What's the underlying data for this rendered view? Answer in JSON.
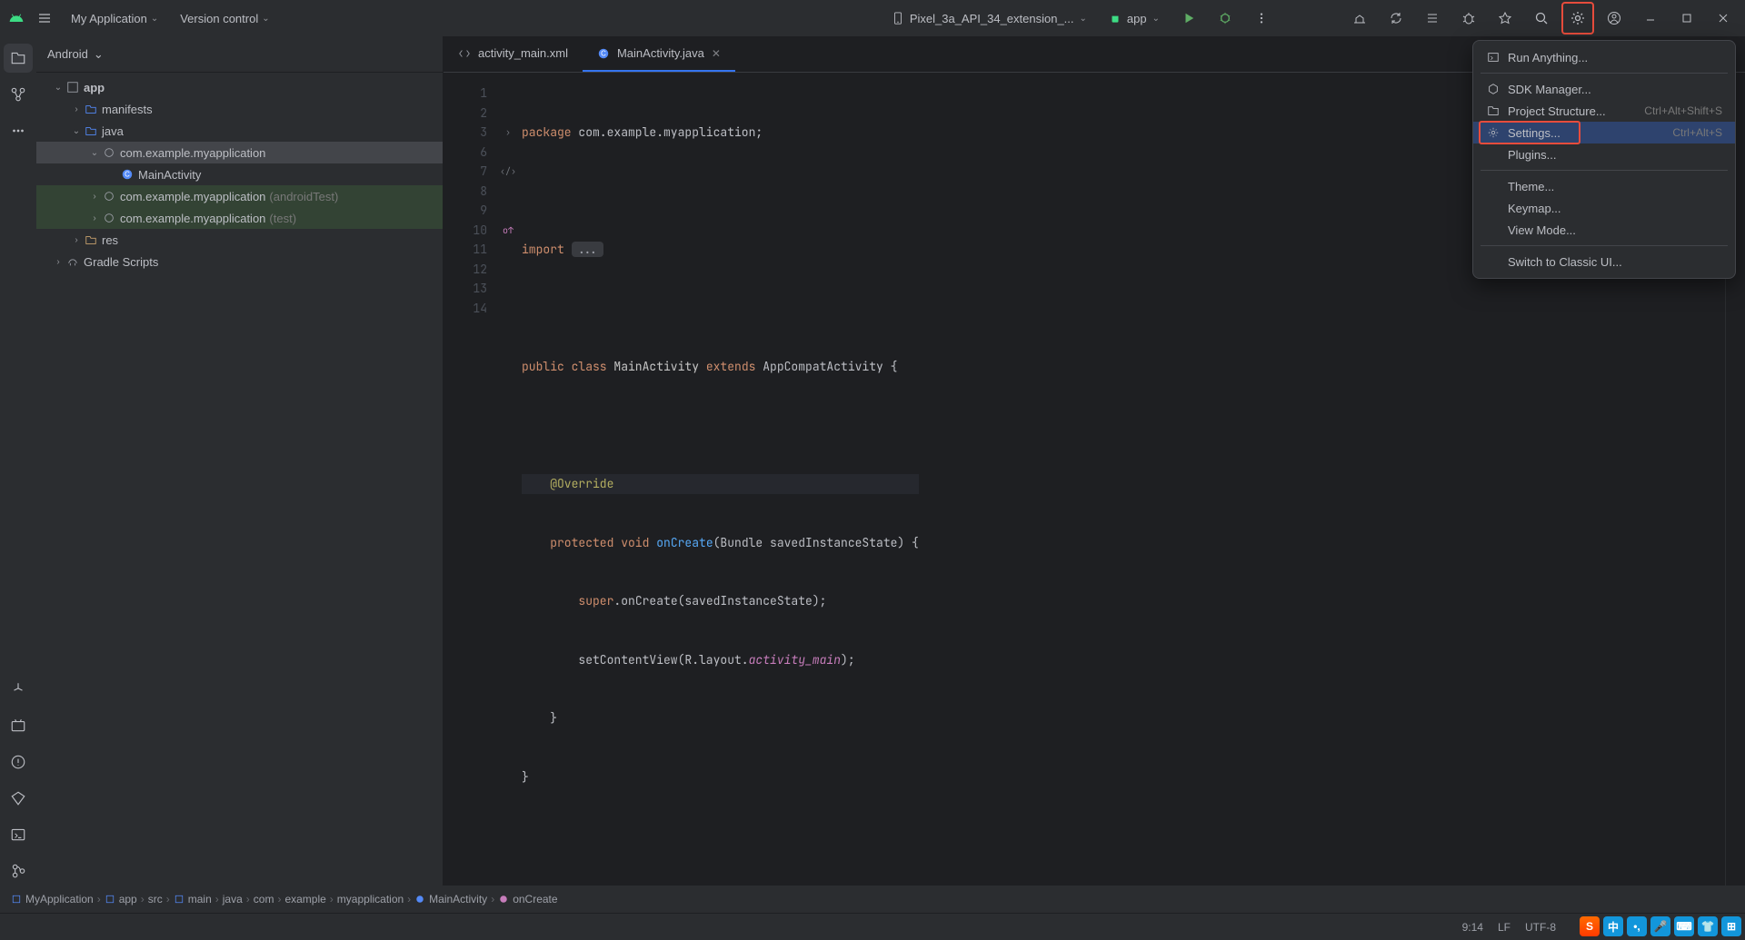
{
  "titlebar": {
    "project": "My Application",
    "vcs": "Version control",
    "device": "Pixel_3a_API_34_extension_...",
    "run_config": "app"
  },
  "panel": {
    "title": "Android"
  },
  "tree": {
    "app": "app",
    "manifests": "manifests",
    "java": "java",
    "pkg1": "com.example.myapplication",
    "activity": "MainActivity",
    "pkg2": "com.example.myapplication",
    "pkg2_suffix": "(androidTest)",
    "pkg3": "com.example.myapplication",
    "pkg3_suffix": "(test)",
    "res": "res",
    "gradle": "Gradle Scripts"
  },
  "tabs": {
    "xml": "activity_main.xml",
    "java": "MainActivity.java"
  },
  "code": {
    "l1a": "package",
    "l1b": " com.example.myapplication;",
    "l3a": "import",
    "l3b": " ",
    "l3c": "...",
    "l7a": "public class",
    "l7b": " MainActivity ",
    "l7c": "extends",
    "l7d": " AppCompatActivity {",
    "l9a": "    ",
    "l9b": "@Override",
    "l10a": "    ",
    "l10b": "protected void",
    "l10c": " ",
    "l10d": "onCreate",
    "l10e": "(Bundle savedInstanceState) {",
    "l11a": "        ",
    "l11b": "super",
    "l11c": ".onCreate(savedInstanceState);",
    "l12a": "        setContentView(R.layout.",
    "l12b": "activity_main",
    "l12c": ");",
    "l13": "    }",
    "l14": "}"
  },
  "gutter": [
    "1",
    "2",
    "3",
    "6",
    "7",
    "8",
    "9",
    "10",
    "11",
    "12",
    "13",
    "14"
  ],
  "menu": {
    "run_anything": "Run Anything...",
    "sdk": "SDK Manager...",
    "proj_struct": "Project Structure...",
    "proj_struct_sc": "Ctrl+Alt+Shift+S",
    "settings": "Settings...",
    "settings_sc": "Ctrl+Alt+S",
    "plugins": "Plugins...",
    "theme": "Theme...",
    "keymap": "Keymap...",
    "view_mode": "View Mode...",
    "classic": "Switch to Classic UI..."
  },
  "breadcrumb": {
    "c1": "MyApplication",
    "c2": "app",
    "c3": "src",
    "c4": "main",
    "c5": "java",
    "c6": "com",
    "c7": "example",
    "c8": "myapplication",
    "c9": "MainActivity",
    "c10": "onCreate"
  },
  "statusbar": {
    "pos": "9:14",
    "lf": "LF",
    "enc": "UTF-8"
  },
  "ime": {
    "a": "S",
    "b": "中",
    "c": "•,",
    "d": "🎤",
    "e": "⌨",
    "f": "👕",
    "g": "⊞"
  }
}
